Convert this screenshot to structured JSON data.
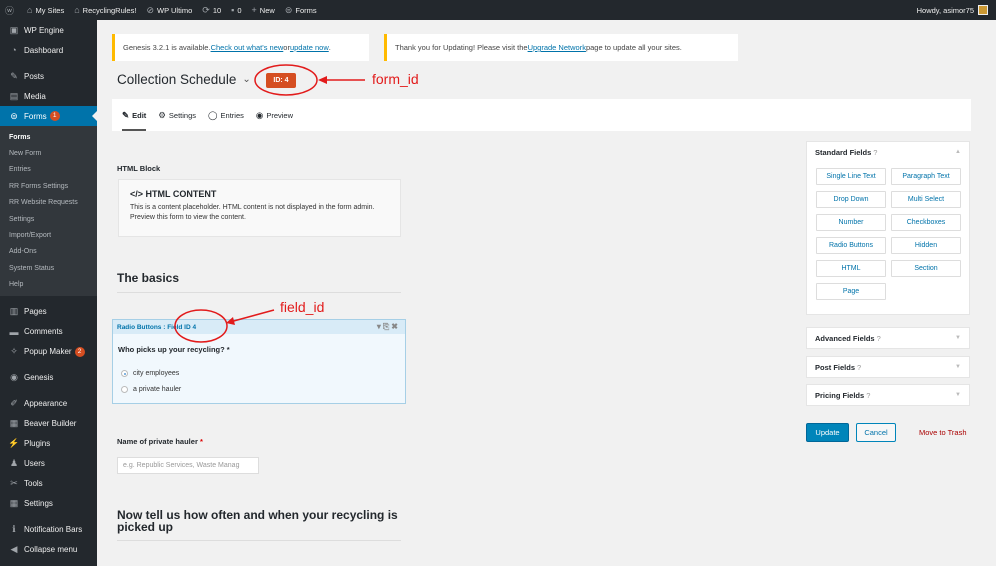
{
  "adminbar": {
    "items": [
      {
        "icon": "wordpress-icon",
        "glyph": "ⓦ",
        "label": ""
      },
      {
        "icon": "my-sites-icon",
        "glyph": "⌂",
        "label": "My Sites"
      },
      {
        "icon": "home-icon",
        "glyph": "⌂",
        "label": "RecyclingRules!"
      },
      {
        "icon": "wp-ultimo-icon",
        "glyph": "⊘",
        "label": "WP Ultimo"
      },
      {
        "icon": "updates-icon",
        "glyph": "⟳",
        "label": "10"
      },
      {
        "icon": "comments-icon",
        "glyph": "▪",
        "label": "0"
      },
      {
        "icon": "plus-icon",
        "glyph": "+",
        "label": "New"
      },
      {
        "icon": "forms-icon",
        "glyph": "⊜",
        "label": "Forms"
      }
    ],
    "greeting": "Howdy, asimor75"
  },
  "sidebar": {
    "top": [
      {
        "label": "WP Engine",
        "icon": "wp-engine-icon",
        "glyph": "▣"
      },
      {
        "label": "Dashboard",
        "icon": "dashboard-icon",
        "glyph": "◔"
      }
    ],
    "mid": [
      {
        "label": "Posts",
        "icon": "pin-icon",
        "glyph": "✎"
      },
      {
        "label": "Media",
        "icon": "media-icon",
        "glyph": "▤"
      }
    ],
    "forms": {
      "label": "Forms",
      "badge": "1"
    },
    "submenu": [
      "Forms",
      "New Form",
      "Entries",
      "RR Forms Settings",
      "RR Website Requests",
      "Settings",
      "Import/Export",
      "Add-Ons",
      "System Status",
      "Help"
    ],
    "lower": [
      {
        "label": "Pages",
        "icon": "pages-icon",
        "glyph": "▥"
      },
      {
        "label": "Comments",
        "icon": "comment-icon",
        "glyph": "▬"
      },
      {
        "label": "Popup Maker",
        "icon": "popup-icon",
        "glyph": "✧",
        "badge": "2"
      }
    ],
    "genesis": {
      "label": "Genesis",
      "icon": "genesis-icon",
      "glyph": "◉"
    },
    "bottom": [
      {
        "label": "Appearance",
        "icon": "appearance-icon",
        "glyph": "✐"
      },
      {
        "label": "Beaver Builder",
        "icon": "beaver-builder-icon",
        "glyph": "▦"
      },
      {
        "label": "Plugins",
        "icon": "plugins-icon",
        "glyph": "⚡"
      },
      {
        "label": "Users",
        "icon": "users-icon",
        "glyph": "♟"
      },
      {
        "label": "Tools",
        "icon": "tools-icon",
        "glyph": "✂"
      },
      {
        "label": "Settings",
        "icon": "settings-icon",
        "glyph": "▦"
      }
    ],
    "tail": [
      {
        "label": "Notification Bars",
        "icon": "info-icon",
        "glyph": "ℹ"
      },
      {
        "label": "Collapse menu",
        "icon": "collapse-icon",
        "glyph": "◀"
      }
    ]
  },
  "notices": {
    "genesis": {
      "pre": "Genesis 3.2.1 is available. ",
      "link1": "Check out what's new",
      "mid": " or ",
      "link2": "update now",
      "post": "."
    },
    "network": {
      "pre": "Thank you for Updating! Please visit the ",
      "link": "Upgrade Network",
      "post": " page to update all your sites."
    }
  },
  "form": {
    "title": "Collection Schedule",
    "id_badge": "ID: 4",
    "tabs": [
      {
        "label": "Edit",
        "icon": "edit-icon",
        "glyph": "✎"
      },
      {
        "label": "Settings",
        "icon": "gears-icon",
        "glyph": "⚙"
      },
      {
        "label": "Entries",
        "icon": "entries-icon",
        "glyph": "◯"
      },
      {
        "label": "Preview",
        "icon": "eye-icon",
        "glyph": "◉"
      }
    ],
    "html_block_label": "HTML Block",
    "html_content_title": "</> HTML CONTENT",
    "html_content_text": "This is a content placeholder. HTML content is not displayed in the form admin. Preview this form to view the content.",
    "section1": "The basics",
    "field_header": "Radio Buttons : Field ID 4",
    "field_question": "Who picks up your recycling? *",
    "radio_options": [
      "city employees",
      "a private hauler"
    ],
    "hauler_label": "Name of private hauler",
    "hauler_required": "*",
    "hauler_placeholder": "e.g. Republic Services, Waste Manag",
    "section2": "Now tell us how often and when your recycling is picked up"
  },
  "panels": {
    "standard": {
      "title": "Standard Fields",
      "buttons": [
        "Single Line Text",
        "Paragraph Text",
        "Drop Down",
        "Multi Select",
        "Number",
        "Checkboxes",
        "Radio Buttons",
        "Hidden",
        "HTML",
        "Section",
        "Page"
      ]
    },
    "advanced": "Advanced Fields",
    "post": "Post Fields",
    "pricing": "Pricing Fields"
  },
  "actions": {
    "update": "Update",
    "cancel": "Cancel",
    "trash": "Move to Trash"
  },
  "annotations": {
    "form_id": "form_id",
    "field_id": "field_id"
  }
}
